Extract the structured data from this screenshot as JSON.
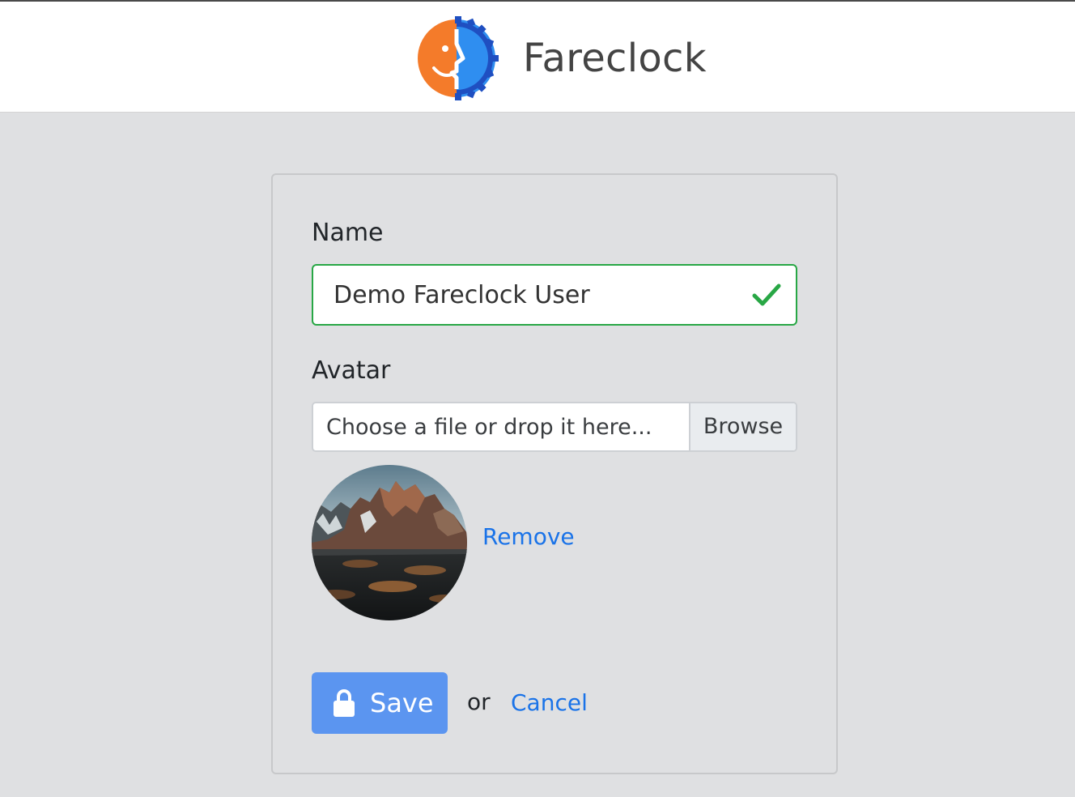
{
  "header": {
    "brand": "Fareclock",
    "logo_icon": "fareclock-logo-icon",
    "colors": {
      "orange": "#f47b2a",
      "blue": "#2f8ef0",
      "dark_blue": "#1f4fc1"
    }
  },
  "form": {
    "name_label": "Name",
    "name_value": "Demo Fareclock User",
    "name_valid": true,
    "avatar_label": "Avatar",
    "file_placeholder": "Choose a file or drop it here...",
    "browse_label": "Browse",
    "remove_label": "Remove",
    "save_label": "Save",
    "or_text": "or",
    "cancel_label": "Cancel"
  },
  "colors": {
    "valid_border": "#28a745",
    "link": "#1a73e8",
    "primary_button": "#5b95f0",
    "page_background": "#dfe0e2"
  }
}
